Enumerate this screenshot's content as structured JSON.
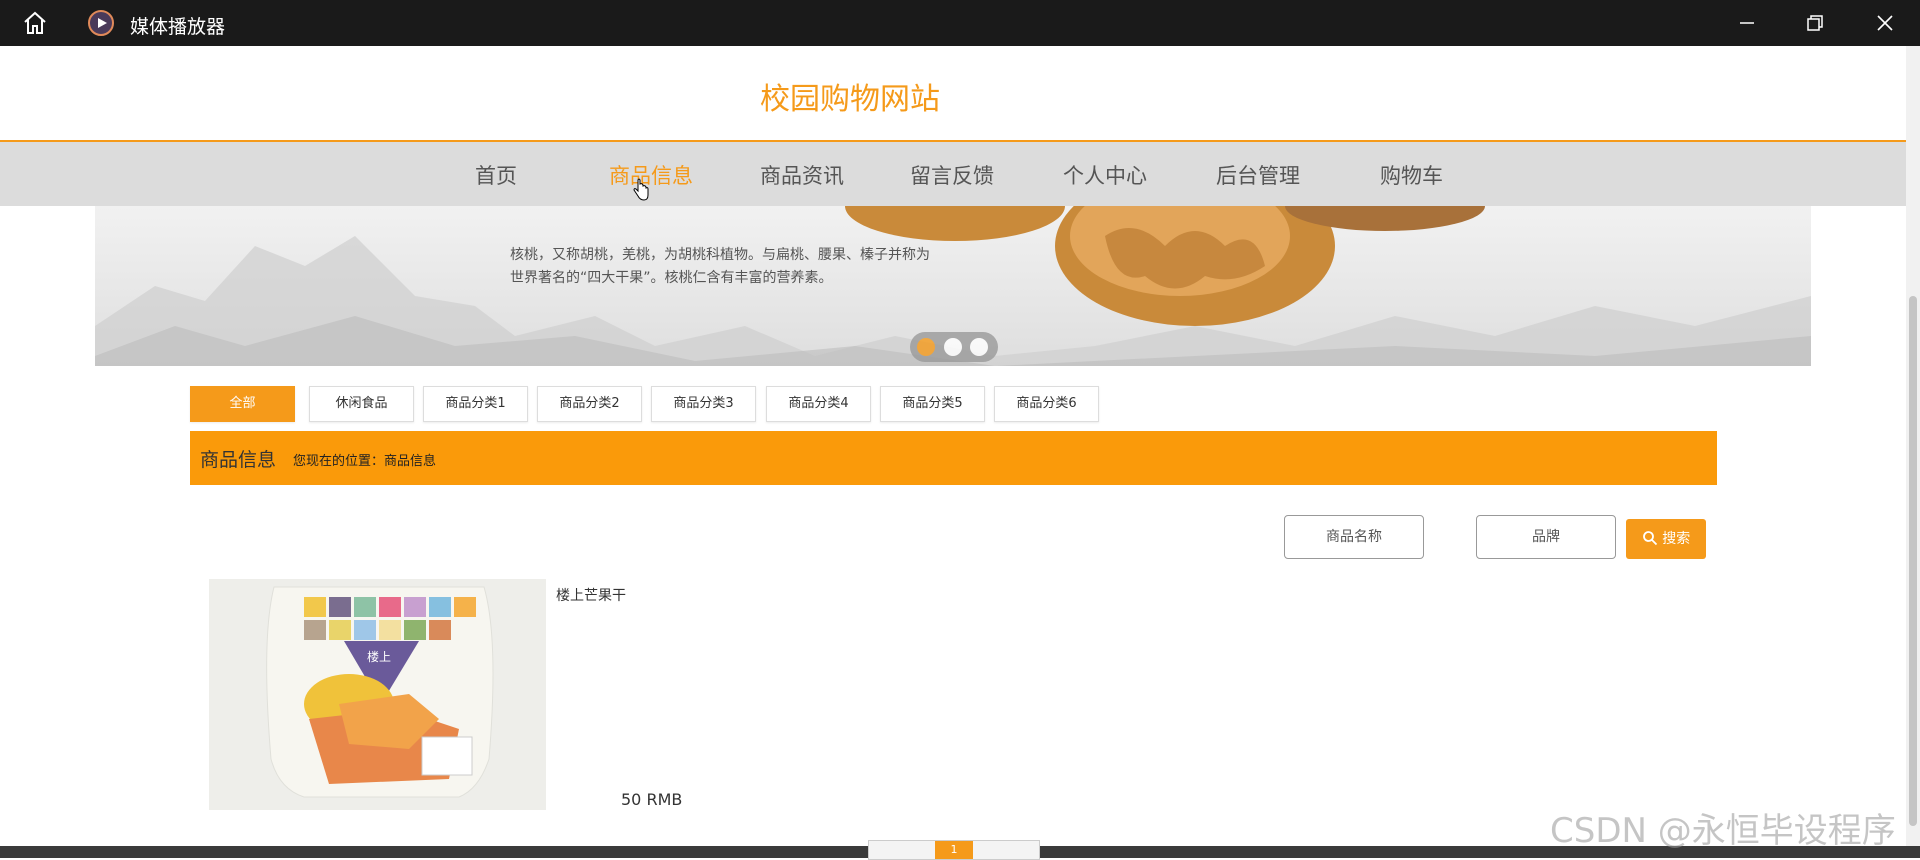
{
  "window": {
    "title": "媒体播放器",
    "icons": {
      "home": "home-icon",
      "app": "media-player-icon",
      "minimize": "minimize-icon",
      "restore": "restore-icon",
      "close": "close-icon"
    }
  },
  "site": {
    "title": "校园购物网站"
  },
  "nav": {
    "items": [
      {
        "label": "首页",
        "active": false
      },
      {
        "label": "商品信息",
        "active": true
      },
      {
        "label": "商品资讯",
        "active": false
      },
      {
        "label": "留言反馈",
        "active": false
      },
      {
        "label": "个人中心",
        "active": false
      },
      {
        "label": "后台管理",
        "active": false
      },
      {
        "label": "购物车",
        "active": false
      }
    ]
  },
  "banner": {
    "text": "核桃，又称胡桃，羌桃，为胡桃科植物。与扁桃、腰果、榛子并称为世界著名的“四大干果”。核桃仁含有丰富的营养素。",
    "slide_count": 3,
    "active_slide": 1
  },
  "categories": [
    {
      "label": "全部",
      "active": true
    },
    {
      "label": "休闲食品",
      "active": false
    },
    {
      "label": "商品分类1",
      "active": false
    },
    {
      "label": "商品分类2",
      "active": false
    },
    {
      "label": "商品分类3",
      "active": false
    },
    {
      "label": "商品分类4",
      "active": false
    },
    {
      "label": "商品分类5",
      "active": false
    },
    {
      "label": "商品分类6",
      "active": false
    }
  ],
  "section": {
    "title": "商品信息",
    "location": "您现在的位置：商品信息"
  },
  "search": {
    "name_placeholder": "商品名称",
    "brand_placeholder": "品牌",
    "button_label": "搜索"
  },
  "products": [
    {
      "name": "楼上芒果干",
      "price": "50 RMB",
      "package_text": "楼上"
    }
  ],
  "pagination": {
    "current": "1"
  },
  "watermark": "CSDN @永恒毕设程序",
  "colors": {
    "accent": "#f59a1a",
    "titlebar": "#1a1a1a",
    "nav_bg": "#dcdcdc"
  }
}
